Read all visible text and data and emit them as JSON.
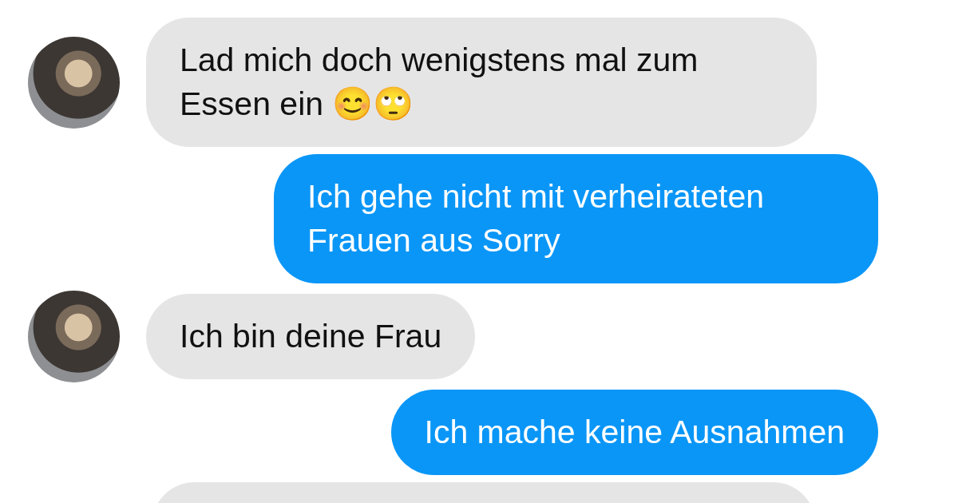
{
  "messages": [
    {
      "kind": "incoming",
      "avatar": true,
      "text": "Lad mich doch wenigstens mal zum Essen ein 😊🙄"
    },
    {
      "kind": "outgoing",
      "text": "Ich gehe nicht mit verheirateten Frauen aus Sorry"
    },
    {
      "kind": "incoming",
      "avatar": true,
      "text": "Ich bin deine Frau"
    },
    {
      "kind": "outgoing",
      "text": "Ich mache keine Ausnahmen"
    },
    {
      "kind": "incoming",
      "avatar": false
    }
  ]
}
